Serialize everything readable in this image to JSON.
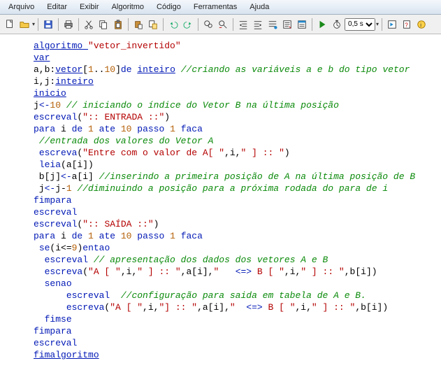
{
  "menu": {
    "items": [
      "Arquivo",
      "Editar",
      "Exibir",
      "Algoritmo",
      "Código",
      "Ferramentas",
      "Ajuda"
    ]
  },
  "toolbar": {
    "new": "new-file",
    "open": "open-file",
    "save": "save-file",
    "print": "print",
    "cut": "cut",
    "copy": "copy",
    "paste": "paste",
    "paste2": "paste-special",
    "copy2": "copy-format",
    "undo": "undo",
    "redo": "redo",
    "find": "find",
    "replace": "replace",
    "indent": "indent",
    "outdent": "outdent",
    "bookmark": "bookmark",
    "goto": "goto",
    "props": "properties",
    "run": "run",
    "stop": "stop",
    "speed_value": "0,5 s",
    "step": "step",
    "doc": "help-doc",
    "about": "about"
  },
  "code": [
    [
      {
        "t": "algoritmo ",
        "c": "kw"
      },
      {
        "t": "\"vetor_invertido\"",
        "c": "str"
      }
    ],
    [
      {
        "t": "var",
        "c": "kw"
      }
    ],
    [
      {
        "t": "a,b:",
        "c": ""
      },
      {
        "t": "vetor",
        "c": "kw"
      },
      {
        "t": "[",
        "c": ""
      },
      {
        "t": "1",
        "c": "nm"
      },
      {
        "t": "..",
        "c": ""
      },
      {
        "t": "10",
        "c": "nm"
      },
      {
        "t": "]",
        "c": ""
      },
      {
        "t": "de ",
        "c": "kwp"
      },
      {
        "t": "inteiro",
        "c": "kw"
      },
      {
        "t": " ",
        "c": ""
      },
      {
        "t": "//criando as variáveis a e b do tipo vetor",
        "c": "cm"
      }
    ],
    [
      {
        "t": "i,j:",
        "c": ""
      },
      {
        "t": "inteiro",
        "c": "kw"
      }
    ],
    [
      {
        "t": "inicio",
        "c": "kw"
      }
    ],
    [
      {
        "t": "j",
        "c": ""
      },
      {
        "t": "<-",
        "c": "op"
      },
      {
        "t": "10",
        "c": "nm"
      },
      {
        "t": " ",
        "c": ""
      },
      {
        "t": "// iniciando o índice do Vetor B na última posição",
        "c": "cm"
      }
    ],
    [
      {
        "t": "escreval",
        "c": "kwp"
      },
      {
        "t": "(",
        "c": ""
      },
      {
        "t": "\":: ENTRADA ::\"",
        "c": "str"
      },
      {
        "t": ")",
        "c": ""
      }
    ],
    [
      {
        "t": "para ",
        "c": "kwp"
      },
      {
        "t": "i ",
        "c": ""
      },
      {
        "t": "de ",
        "c": "kwp"
      },
      {
        "t": "1",
        "c": "nm"
      },
      {
        "t": " ate ",
        "c": "kwp"
      },
      {
        "t": "10",
        "c": "nm"
      },
      {
        "t": " passo ",
        "c": "kwp"
      },
      {
        "t": "1",
        "c": "nm"
      },
      {
        "t": " faca",
        "c": "kwp"
      }
    ],
    [
      {
        "t": " ",
        "c": ""
      },
      {
        "t": "//entrada dos valores do Vetor A",
        "c": "cm"
      }
    ],
    [
      {
        "t": " ",
        "c": ""
      },
      {
        "t": "escreva",
        "c": "kwp"
      },
      {
        "t": "(",
        "c": ""
      },
      {
        "t": "\"Entre com o valor de A[ \"",
        "c": "str"
      },
      {
        "t": ",i,",
        "c": ""
      },
      {
        "t": "\" ] :: \"",
        "c": "str"
      },
      {
        "t": ")",
        "c": ""
      }
    ],
    [
      {
        "t": " ",
        "c": ""
      },
      {
        "t": "leia",
        "c": "kwp"
      },
      {
        "t": "(a[i])",
        "c": ""
      }
    ],
    [
      {
        "t": " b[j]",
        "c": ""
      },
      {
        "t": "<-",
        "c": "op"
      },
      {
        "t": "a[i] ",
        "c": ""
      },
      {
        "t": "//inserindo a primeira posição de A na última posição de B",
        "c": "cm"
      }
    ],
    [
      {
        "t": " j",
        "c": ""
      },
      {
        "t": "<-",
        "c": "op"
      },
      {
        "t": "j-",
        "c": ""
      },
      {
        "t": "1",
        "c": "nm"
      },
      {
        "t": " ",
        "c": ""
      },
      {
        "t": "//diminuindo a posição para a próxima rodada do para de i",
        "c": "cm"
      }
    ],
    [
      {
        "t": "fimpara",
        "c": "kwp"
      }
    ],
    [
      {
        "t": "escreval",
        "c": "kwp"
      }
    ],
    [
      {
        "t": "escreval",
        "c": "kwp"
      },
      {
        "t": "(",
        "c": ""
      },
      {
        "t": "\":: SAÍDA ::\"",
        "c": "str"
      },
      {
        "t": ")",
        "c": ""
      }
    ],
    [
      {
        "t": "para ",
        "c": "kwp"
      },
      {
        "t": "i ",
        "c": ""
      },
      {
        "t": "de ",
        "c": "kwp"
      },
      {
        "t": "1",
        "c": "nm"
      },
      {
        "t": " ate ",
        "c": "kwp"
      },
      {
        "t": "10",
        "c": "nm"
      },
      {
        "t": " passo ",
        "c": "kwp"
      },
      {
        "t": "1",
        "c": "nm"
      },
      {
        "t": " faca",
        "c": "kwp"
      }
    ],
    [
      {
        "t": " ",
        "c": ""
      },
      {
        "t": "se",
        "c": "kwp"
      },
      {
        "t": "(i<=",
        "c": ""
      },
      {
        "t": "9",
        "c": "nm"
      },
      {
        "t": ")",
        "c": ""
      },
      {
        "t": "entao",
        "c": "kwp"
      }
    ],
    [
      {
        "t": "  ",
        "c": ""
      },
      {
        "t": "escreval",
        "c": "kwp"
      },
      {
        "t": " ",
        "c": ""
      },
      {
        "t": "// apresentação dos dados dos vetores A e B",
        "c": "cm"
      }
    ],
    [
      {
        "t": "  ",
        "c": ""
      },
      {
        "t": "escreva",
        "c": "kwp"
      },
      {
        "t": "(",
        "c": ""
      },
      {
        "t": "\"A [ \"",
        "c": "str"
      },
      {
        "t": ",i,",
        "c": ""
      },
      {
        "t": "\" ] :: \"",
        "c": "str"
      },
      {
        "t": ",a[i],",
        "c": ""
      },
      {
        "t": "\"   ",
        "c": "str"
      },
      {
        "t": "<=>",
        "c": "op"
      },
      {
        "t": " B [ \"",
        "c": "str"
      },
      {
        "t": ",i,",
        "c": ""
      },
      {
        "t": "\" ] :: \"",
        "c": "str"
      },
      {
        "t": ",b[i])",
        "c": ""
      }
    ],
    [
      {
        "t": "  ",
        "c": ""
      },
      {
        "t": "senao",
        "c": "kwp"
      }
    ],
    [
      {
        "t": "      ",
        "c": ""
      },
      {
        "t": "escreval",
        "c": "kwp"
      },
      {
        "t": "  ",
        "c": ""
      },
      {
        "t": "//configuração para saida em tabela de A e B.",
        "c": "cm"
      }
    ],
    [
      {
        "t": "      ",
        "c": ""
      },
      {
        "t": "escreva",
        "c": "kwp"
      },
      {
        "t": "(",
        "c": ""
      },
      {
        "t": "\"A [ \"",
        "c": "str"
      },
      {
        "t": ",i,",
        "c": ""
      },
      {
        "t": "\"] :: \"",
        "c": "str"
      },
      {
        "t": ",a[i],",
        "c": ""
      },
      {
        "t": "\"  ",
        "c": "str"
      },
      {
        "t": "<=>",
        "c": "op"
      },
      {
        "t": " B [ \"",
        "c": "str"
      },
      {
        "t": ",i,",
        "c": ""
      },
      {
        "t": "\" ] :: \"",
        "c": "str"
      },
      {
        "t": ",b[i])",
        "c": ""
      }
    ],
    [
      {
        "t": "  ",
        "c": ""
      },
      {
        "t": "fimse",
        "c": "kwp"
      }
    ],
    [
      {
        "t": "fimpara",
        "c": "kwp"
      }
    ],
    [
      {
        "t": "escreval",
        "c": "kwp"
      }
    ],
    [
      {
        "t": "fimalgoritmo",
        "c": "kw"
      }
    ]
  ]
}
